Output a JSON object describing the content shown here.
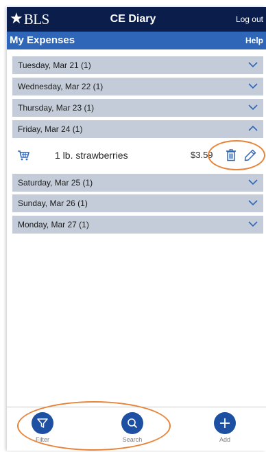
{
  "header": {
    "logo_text": "BLS",
    "app_title": "CE Diary",
    "logout_label": "Log out"
  },
  "subheader": {
    "title": "My Expenses",
    "help_label": "Help"
  },
  "days": [
    {
      "label": "Tuesday, Mar 21   (1)",
      "expanded": false
    },
    {
      "label": "Wednesday, Mar 22   (1)",
      "expanded": false
    },
    {
      "label": "Thursday, Mar 23   (1)",
      "expanded": false
    },
    {
      "label": "Friday, Mar 24   (1)",
      "expanded": true
    },
    {
      "label": "Saturday, Mar 25   (1)",
      "expanded": false
    },
    {
      "label": "Sunday, Mar 26   (1)",
      "expanded": false
    },
    {
      "label": "Monday, Mar 27   (1)",
      "expanded": false
    }
  ],
  "expanded_entry": {
    "description": "1 lb. strawberries",
    "price": "$3.59",
    "icons": [
      "cart-icon",
      "trash-icon",
      "pencil-icon"
    ]
  },
  "bottom_nav": {
    "filter_label": "Filter",
    "search_label": "Search",
    "add_label": "Add"
  },
  "colors": {
    "header_bg": "#0b1d4a",
    "subheader_bg": "#2f66b8",
    "day_bg": "#c3ccd8",
    "accent": "#1d4fa2",
    "annotation": "#e8833a"
  }
}
